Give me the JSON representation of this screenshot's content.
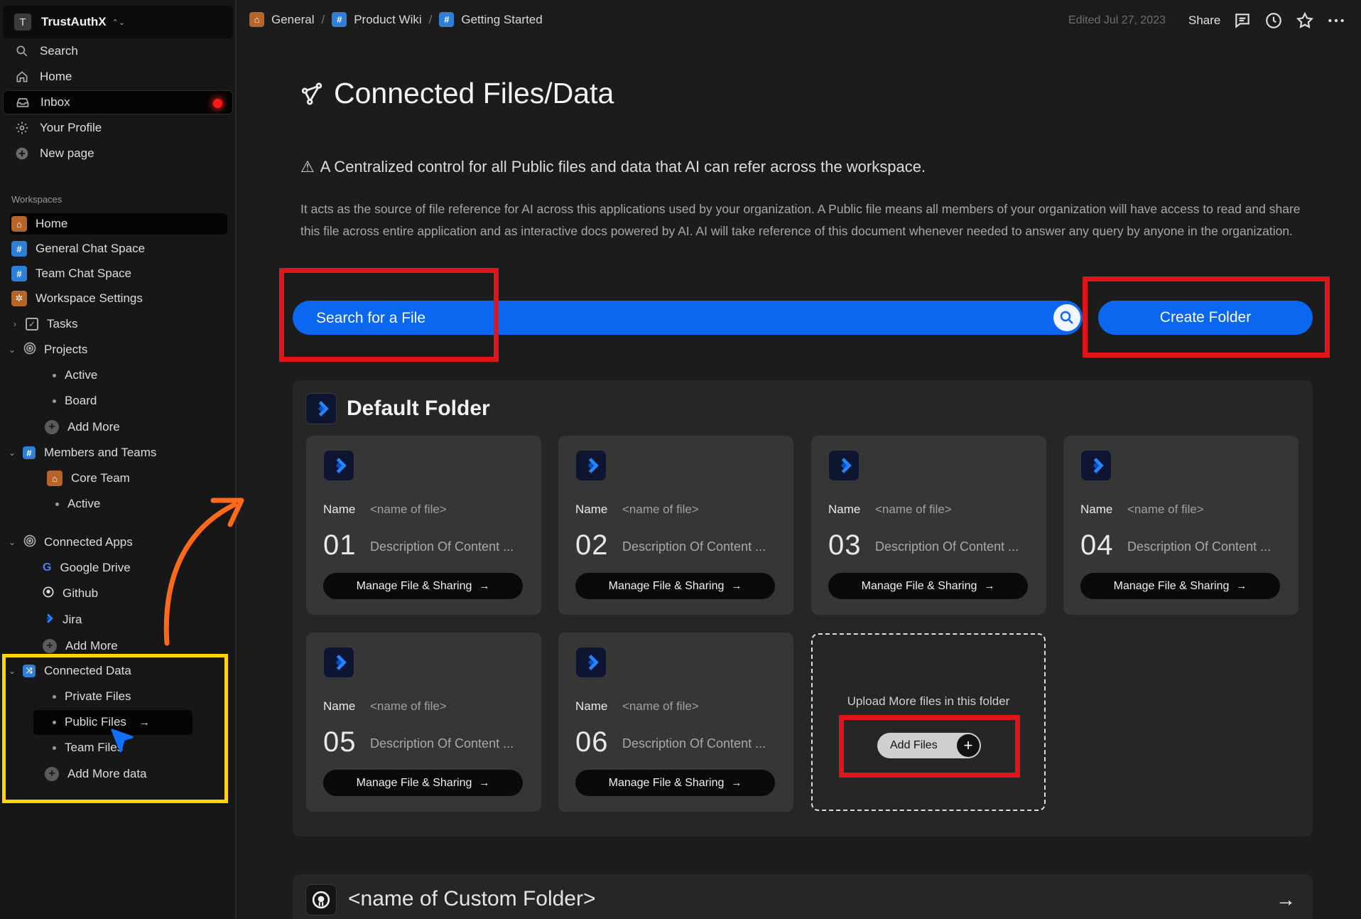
{
  "sidebar": {
    "workspace": {
      "avatar": "T",
      "name": "TrustAuthX"
    },
    "nav": [
      {
        "label": "Search",
        "icon": "search-icon"
      },
      {
        "label": "Home",
        "icon": "home-icon"
      },
      {
        "label": "Inbox",
        "icon": "inbox-icon"
      },
      {
        "label": "Your Profile",
        "icon": "gear-icon"
      },
      {
        "label": "New page",
        "icon": "plus-circle-icon"
      }
    ],
    "workspaces_label": "Workspaces",
    "tree": {
      "home": "Home",
      "general_chat": "General Chat Space",
      "team_chat": "Team Chat Space",
      "workspace_settings": "Workspace Settings",
      "tasks": "Tasks",
      "projects": "Projects",
      "projects_active": "Active",
      "projects_board": "Board",
      "projects_add": "Add More",
      "members_teams": "Members and Teams",
      "core_team": "Core Team",
      "members_active": "Active",
      "connected_apps": "Connected Apps",
      "google_drive": "Google Drive",
      "github": "Github",
      "jira": "Jira",
      "apps_add": "Add More",
      "connected_data": "Connected Data",
      "private_files": "Private Files",
      "public_files": "Public  Files",
      "team_files": "Team Files",
      "add_more_data": "Add More data"
    }
  },
  "topbar": {
    "breadcrumbs": [
      "General",
      "Product Wiki",
      "Getting Started"
    ],
    "edited": "Edited Jul 27, 2023",
    "share": "Share"
  },
  "main": {
    "title": "Connected Files/Data",
    "warning": "A Centralized control for all Public files and data that AI can refer across the workspace.",
    "description": "It acts as the source of file reference for AI across this applications used by your organization. A Public file means all members of your organization will have access to read and share this file across entire application and as interactive docs powered by AI. AI will take reference of this document whenever needed to answer any query by anyone in the organization.",
    "search_placeholder": "Search for a File",
    "create_folder": "Create Folder",
    "default_folder": {
      "title": "Default Folder",
      "cards": [
        {
          "name_label": "Name",
          "name_value": "<name of file>",
          "number": "01",
          "description": "Description Of Content ...",
          "button": "Manage File & Sharing"
        },
        {
          "name_label": "Name",
          "name_value": "<name of file>",
          "number": "02",
          "description": "Description Of Content ...",
          "button": "Manage File & Sharing"
        },
        {
          "name_label": "Name",
          "name_value": "<name of file>",
          "number": "03",
          "description": "Description Of Content ...",
          "button": "Manage File & Sharing"
        },
        {
          "name_label": "Name",
          "name_value": "<name of file>",
          "number": "04",
          "description": "Description Of Content ...",
          "button": "Manage File & Sharing"
        },
        {
          "name_label": "Name",
          "name_value": "<name of file>",
          "number": "05",
          "description": "Description Of Content ...",
          "button": "Manage File & Sharing"
        },
        {
          "name_label": "Name",
          "name_value": "<name of file>",
          "number": "06",
          "description": "Description Of Content ...",
          "button": "Manage File & Sharing"
        }
      ],
      "upload_text": "Upload More files in this folder",
      "add_files": "Add Files"
    },
    "custom_folder": {
      "title": "<name of Custom Folder>"
    }
  },
  "colors": {
    "accent": "#0b67f0",
    "annotation_red": "#e0141a",
    "annotation_yellow": "#ffd600",
    "annotation_orange": "#ff6a1a",
    "notification": "#ff1a1a"
  }
}
